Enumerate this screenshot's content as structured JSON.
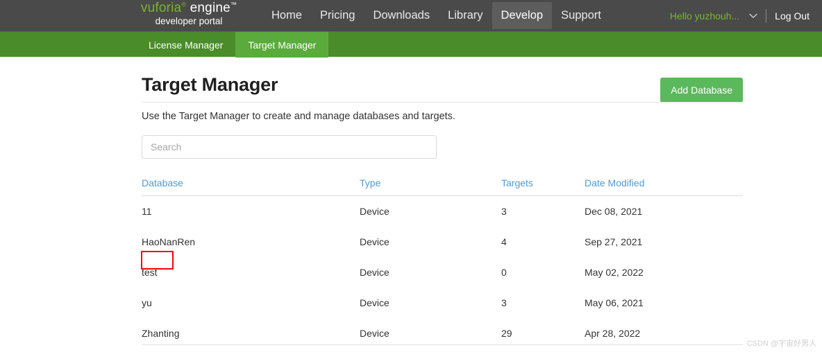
{
  "header": {
    "logo": {
      "primary": "vuforia",
      "tm": "®",
      "secondary": "engine",
      "tm2": "™",
      "tagline": "developer portal"
    },
    "nav": [
      {
        "label": "Home",
        "active": false
      },
      {
        "label": "Pricing",
        "active": false
      },
      {
        "label": "Downloads",
        "active": false
      },
      {
        "label": "Library",
        "active": false
      },
      {
        "label": "Develop",
        "active": true
      },
      {
        "label": "Support",
        "active": false
      }
    ],
    "user": {
      "greeting": "Hello yuzhouh...",
      "dropdown_icon": "chevron-down-icon",
      "logout_label": "Log Out"
    }
  },
  "subnav": {
    "items": [
      {
        "label": "License Manager",
        "active": false
      },
      {
        "label": "Target Manager",
        "active": true
      }
    ]
  },
  "main": {
    "title": "Target Manager",
    "add_button_label": "Add Database",
    "lead": "Use the Target Manager to create and manage databases and targets.",
    "search": {
      "placeholder": "Search",
      "value": ""
    },
    "table": {
      "columns": [
        "Database",
        "Type",
        "Targets",
        "Date Modified"
      ],
      "rows": [
        {
          "database": "11",
          "type": "Device",
          "targets": "3",
          "date_modified": "Dec 08, 2021",
          "highlighted": false
        },
        {
          "database": "HaoNanRen",
          "type": "Device",
          "targets": "4",
          "date_modified": "Sep 27, 2021",
          "highlighted": false
        },
        {
          "database": "test",
          "type": "Device",
          "targets": "0",
          "date_modified": "May 02, 2022",
          "highlighted": true
        },
        {
          "database": "yu",
          "type": "Device",
          "targets": "3",
          "date_modified": "May 06, 2021",
          "highlighted": false
        },
        {
          "database": "Zhanting",
          "type": "Device",
          "targets": "29",
          "date_modified": "Apr 28, 2022",
          "highlighted": false
        }
      ]
    }
  },
  "watermark": "CSDN @宇宙好男人",
  "colors": {
    "header_bg": "#4a4a4a",
    "header_active_bg": "#5d5d5d",
    "subnav_bg": "#4a8c2a",
    "subnav_active_bg": "#5aab3c",
    "brand_green": "#76b82a",
    "button_green": "#5cb85c",
    "link_blue": "#4f9ad6",
    "annotation_red": "#ff0000"
  }
}
